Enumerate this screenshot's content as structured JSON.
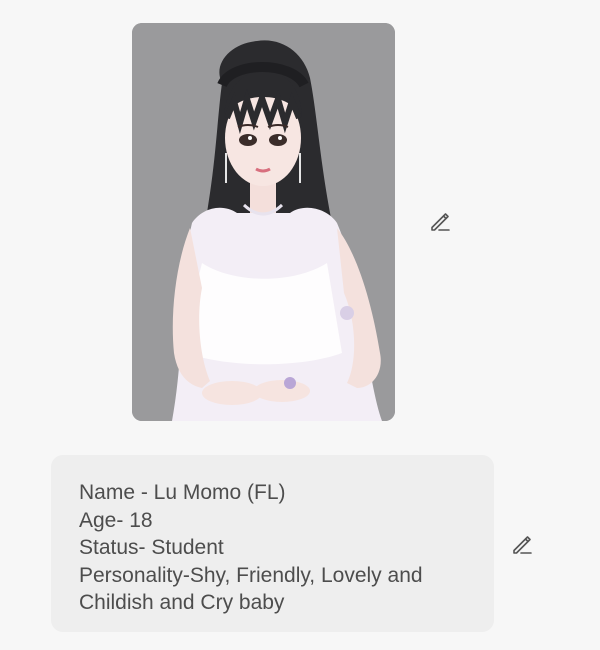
{
  "message_image": {
    "alt": "anime illustration of a girl in a white dress",
    "background_color": "#9a9a9c"
  },
  "icons": {
    "edit_image": "pencil-edit-icon",
    "edit_text": "pencil-edit-icon"
  },
  "profile_text": {
    "name_line": "Name - Lu Momo (FL)",
    "age_line": "Age- 18",
    "status_line": "Status- Student",
    "personality_line_1": "Personality-Shy, Friendly, Lovely and",
    "personality_line_2": "Childish and Cry baby"
  },
  "colors": {
    "page_background": "#f7f7f7",
    "text_bubble": "#eeeeee",
    "text": "#4d4d4d",
    "icon": "#555555"
  }
}
